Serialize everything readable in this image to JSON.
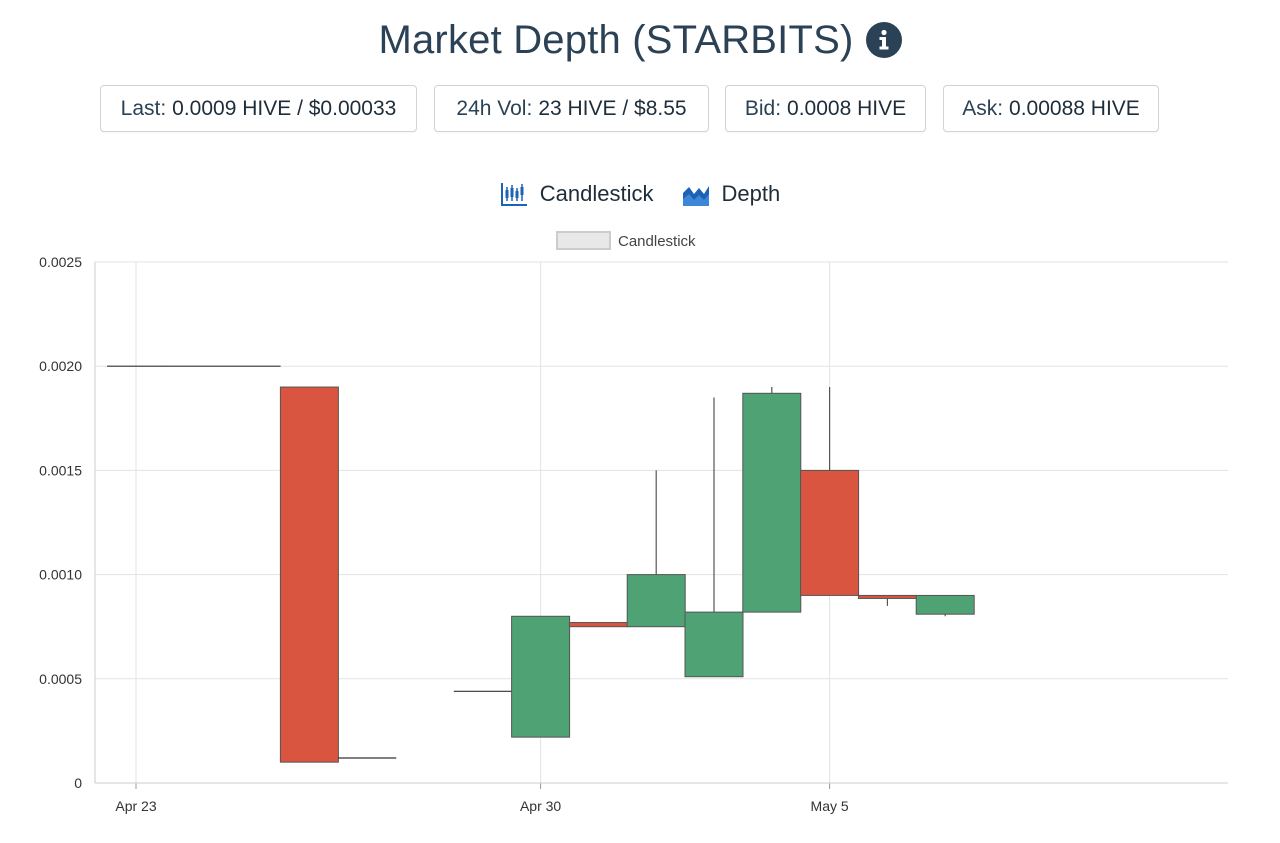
{
  "header": {
    "title": "Market Depth (STARBITS)",
    "info_icon": "info-circle-icon"
  },
  "stats": [
    {
      "label": "Last:",
      "value": "0.0009 HIVE / $0.00033"
    },
    {
      "label": "24h Vol:",
      "value": "23 HIVE / $8.55"
    },
    {
      "label": "Bid:",
      "value": "0.0008 HIVE"
    },
    {
      "label": "Ask:",
      "value": "0.00088 HIVE"
    }
  ],
  "tabs": [
    {
      "label": "Candlestick",
      "icon": "candlestick-chart-icon"
    },
    {
      "label": "Depth",
      "icon": "area-chart-icon"
    }
  ],
  "colors": {
    "up": "#4fa274",
    "down": "#d9553f",
    "neutral": "#333333",
    "accent": "#2b4155",
    "icon_blue": "#1b63b5"
  },
  "chart_data": {
    "type": "candlestick",
    "legend": [
      "Candlestick"
    ],
    "legend_position": "top-center",
    "grid": true,
    "ylim": [
      0,
      0.0025
    ],
    "y_ticks": [
      "0",
      "0.0005",
      "0.0010",
      "0.0015",
      "0.0020",
      "0.0025"
    ],
    "x_tick_labels": [
      "Apr 23",
      "Apr 30",
      "May 5"
    ],
    "x_tick_dates": [
      "Apr 23",
      "Apr 30",
      "May 5"
    ],
    "series": [
      {
        "name": "Candlestick",
        "candles": [
          {
            "date": "Apr 23",
            "open": 0.002,
            "high": 0.002,
            "low": 0.002,
            "close": 0.002
          },
          {
            "date": "Apr 24",
            "open": 0.002,
            "high": 0.002,
            "low": 0.002,
            "close": 0.002
          },
          {
            "date": "Apr 25",
            "open": 0.002,
            "high": 0.002,
            "low": 0.002,
            "close": 0.002
          },
          {
            "date": "Apr 26",
            "open": 0.0019,
            "high": 0.0019,
            "low": 0.0001,
            "close": 0.0001
          },
          {
            "date": "Apr 27",
            "open": 0.00012,
            "high": 0.00012,
            "low": 0.00012,
            "close": 0.00012
          },
          {
            "date": "Apr 29",
            "open": 0.00044,
            "high": 0.00044,
            "low": 0.00044,
            "close": 0.00044
          },
          {
            "date": "Apr 30",
            "open": 0.00022,
            "high": 0.0008,
            "low": 0.00022,
            "close": 0.0008
          },
          {
            "date": "May 1",
            "open": 0.00077,
            "high": 0.00077,
            "low": 0.00075,
            "close": 0.00075
          },
          {
            "date": "May 2",
            "open": 0.00075,
            "high": 0.0015,
            "low": 0.00075,
            "close": 0.001
          },
          {
            "date": "May 3",
            "open": 0.00051,
            "high": 0.00185,
            "low": 0.00051,
            "close": 0.00082
          },
          {
            "date": "May 4",
            "open": 0.00082,
            "high": 0.0019,
            "low": 0.00082,
            "close": 0.00187
          },
          {
            "date": "May 5",
            "open": 0.0015,
            "high": 0.0019,
            "low": 0.0009,
            "close": 0.0009
          },
          {
            "date": "May 6",
            "open": 0.0009,
            "high": 0.0009,
            "low": 0.00085,
            "close": 0.00089
          },
          {
            "date": "May 7",
            "open": 0.00081,
            "high": 0.0009,
            "low": 0.0008,
            "close": 0.0009
          }
        ]
      }
    ]
  }
}
